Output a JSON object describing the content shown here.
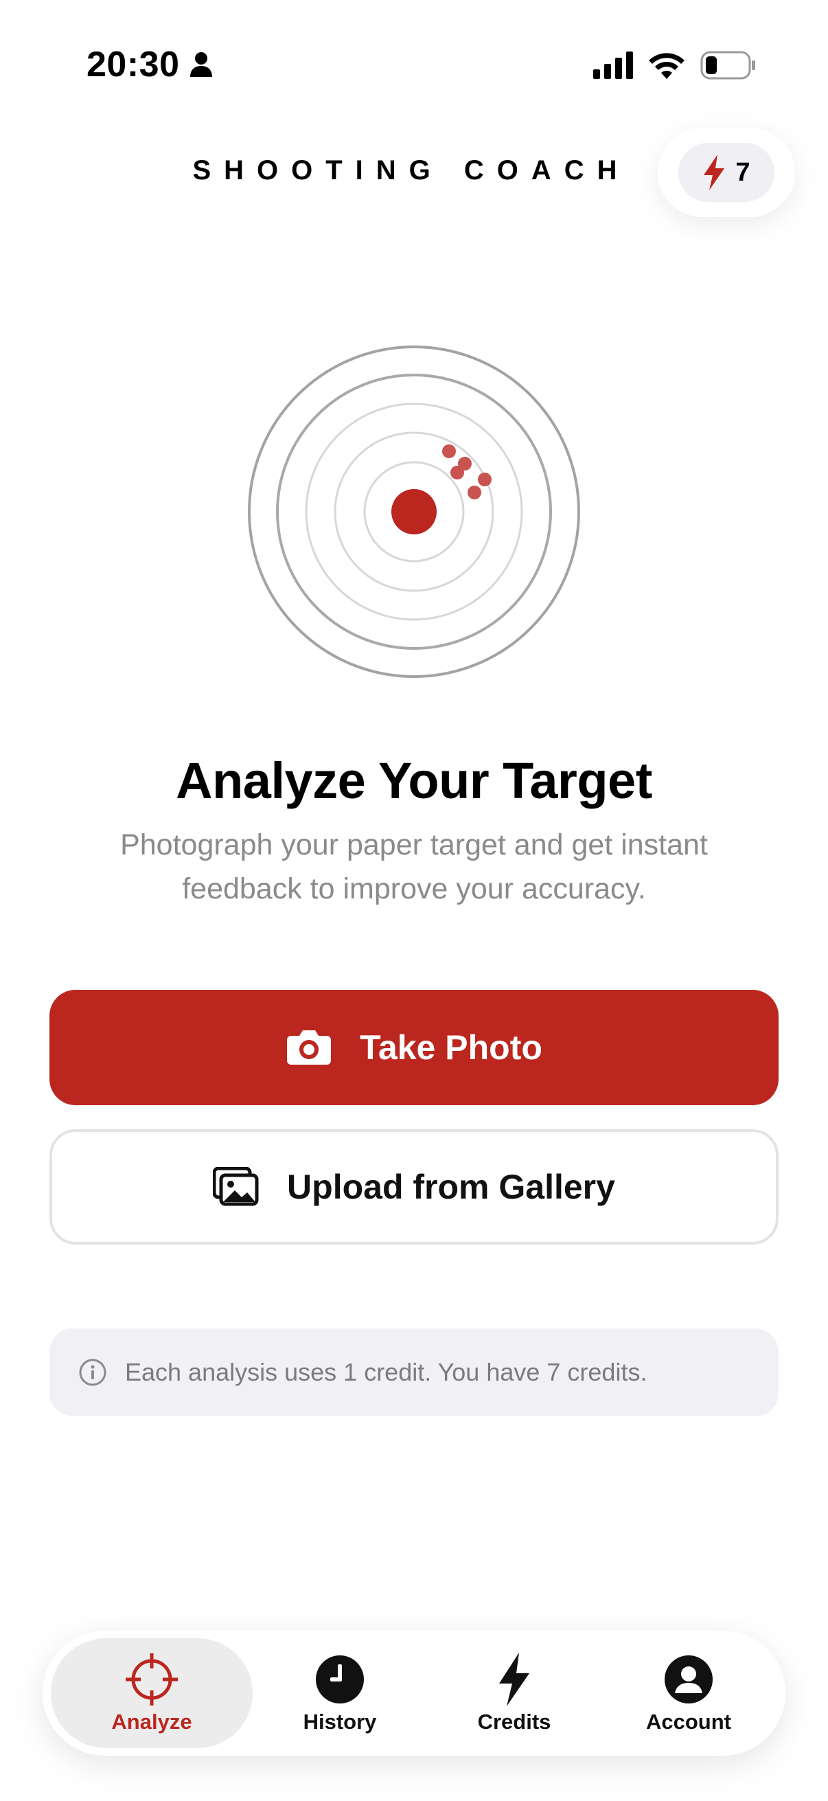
{
  "status_bar": {
    "time": "20:30"
  },
  "header": {
    "title": "SHOOTING COACH",
    "credits_badge": "7"
  },
  "hero": {
    "title": "Analyze Your Target",
    "description": "Photograph your paper target and get instant feedback to improve your accuracy."
  },
  "actions": {
    "take_photo": "Take Photo",
    "upload_gallery": "Upload from Gallery"
  },
  "info": {
    "text": "Each analysis uses 1 credit. You have 7 credits."
  },
  "tabs": [
    {
      "label": "Analyze",
      "icon": "crosshair-icon",
      "active": true
    },
    {
      "label": "History",
      "icon": "clock-icon",
      "active": false
    },
    {
      "label": "Credits",
      "icon": "lightning-icon",
      "active": false
    },
    {
      "label": "Account",
      "icon": "person-icon",
      "active": false
    }
  ],
  "colors": {
    "accent": "#bb261e",
    "muted_text": "#8a8a8e",
    "pill_bg": "#efeff4"
  }
}
